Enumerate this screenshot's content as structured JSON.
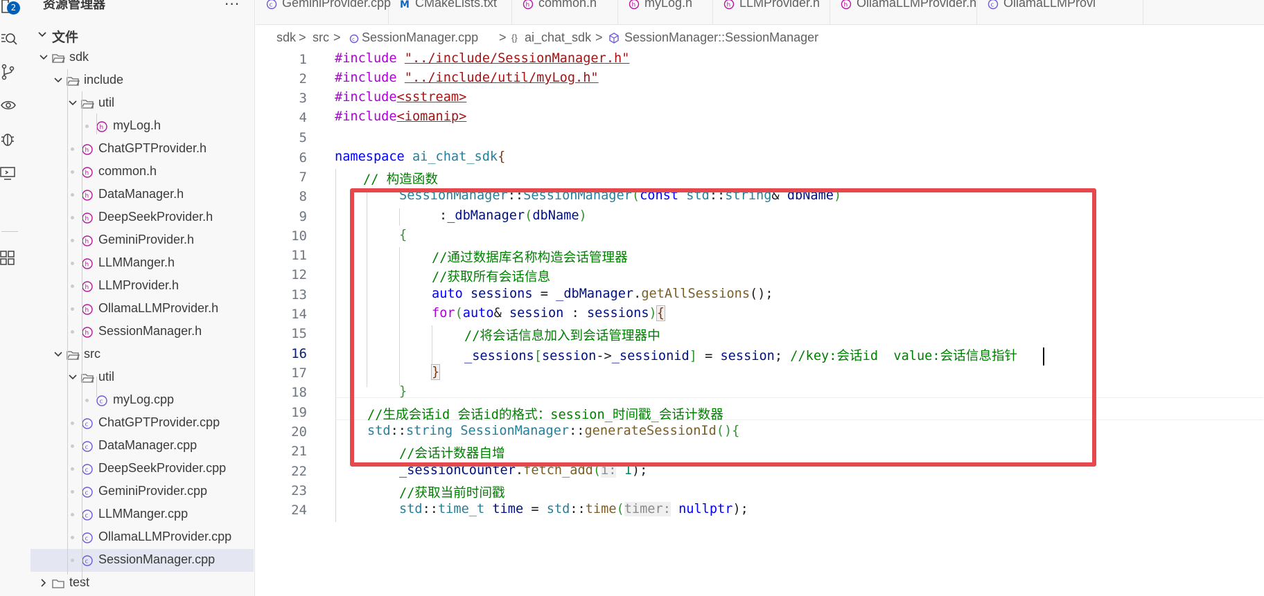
{
  "sidebar": {
    "title": "资源管理器",
    "more_label": "···",
    "section_label": "文件",
    "tree": [
      {
        "label": "sdk",
        "type": "folder-open"
      },
      {
        "label": "include",
        "type": "folder-open"
      },
      {
        "label": "util",
        "type": "folder-open"
      },
      {
        "label": "myLog.h",
        "type": "h"
      },
      {
        "label": "ChatGPTProvider.h",
        "type": "h"
      },
      {
        "label": "common.h",
        "type": "h"
      },
      {
        "label": "DataManager.h",
        "type": "h"
      },
      {
        "label": "DeepSeekProvider.h",
        "type": "h"
      },
      {
        "label": "GeminiProvider.h",
        "type": "h"
      },
      {
        "label": "LLMManger.h",
        "type": "h"
      },
      {
        "label": "LLMProvider.h",
        "type": "h"
      },
      {
        "label": "OllamaLLMProvider.h",
        "type": "h"
      },
      {
        "label": "SessionManager.h",
        "type": "h"
      },
      {
        "label": "src",
        "type": "folder-open"
      },
      {
        "label": "util",
        "type": "folder-open"
      },
      {
        "label": "myLog.cpp",
        "type": "cpp"
      },
      {
        "label": "ChatGPTProvider.cpp",
        "type": "cpp"
      },
      {
        "label": "DataManager.cpp",
        "type": "cpp"
      },
      {
        "label": "DeepSeekProvider.cpp",
        "type": "cpp"
      },
      {
        "label": "GeminiProvider.cpp",
        "type": "cpp"
      },
      {
        "label": "LLMManger.cpp",
        "type": "cpp"
      },
      {
        "label": "OllamaLLMProvider.cpp",
        "type": "cpp"
      },
      {
        "label": "SessionManager.cpp",
        "type": "cpp",
        "selected": true
      },
      {
        "label": "test",
        "type": "folder-closed"
      }
    ]
  },
  "activity_bar": {
    "badge": "2"
  },
  "tabs": [
    {
      "label": "GeminiProvider.cpp",
      "icon": "cpp-file-icon"
    },
    {
      "label": "CMakeLists.txt",
      "icon": "cmake-file-icon"
    },
    {
      "label": "common.h",
      "icon": "h-file-icon"
    },
    {
      "label": "myLog.h",
      "icon": "h-file-icon"
    },
    {
      "label": "LLMProvider.h",
      "icon": "h-file-icon"
    },
    {
      "label": "OllamaLLMProvider.h",
      "icon": "h-file-icon"
    },
    {
      "label": "OllamaLLMProvi",
      "icon": "cpp-file-icon"
    }
  ],
  "breadcrumb": {
    "items": [
      "sdk",
      "src",
      "SessionManager.cpp",
      "ai_chat_sdk",
      "SessionManager::SessionManager"
    ],
    "separator": ">",
    "ns_icon": "{}"
  },
  "editor": {
    "active_line": 16,
    "line_numbers": [
      "1",
      "2",
      "3",
      "4",
      "5",
      "6",
      "7",
      "8",
      "9",
      "10",
      "11",
      "12",
      "13",
      "14",
      "15",
      "16",
      "17",
      "18",
      "19",
      "20",
      "21",
      "22",
      "23",
      "24"
    ],
    "lines": {
      "l1": {
        "kw": "#include",
        "s": "\"../include/SessionManager.h\""
      },
      "l2": {
        "kw": "#include",
        "s": "\"../include/util/myLog.h\""
      },
      "l3": {
        "kw": "#include",
        "s": "<sstream>"
      },
      "l4": {
        "kw": "#include",
        "s": "<iomanip>"
      },
      "l6": {
        "kw": "namespace",
        "ns": "ai_chat_sdk",
        "br": "{"
      },
      "l7": {
        "c": "// 构造函数"
      },
      "l8": {
        "t": "SessionManager",
        "sep": "::",
        "f": "SessionManager",
        "p1": "(",
        "k": "const",
        "t2": "std",
        "sep2": "::",
        "t3": "string",
        "amp": "&",
        "v": "dbName",
        "p2": ")"
      },
      "l9": {
        "colon": ":",
        "v": "_dbManager",
        "p1": "(",
        "v2": "dbName",
        "p2": ")"
      },
      "l10": {
        "br": "{"
      },
      "l11": {
        "c": "//通过数据库名称构造会话管理器"
      },
      "l12": {
        "c": "//获取所有会话信息"
      },
      "l13": {
        "k": "auto",
        "v": "sessions",
        "eq": "=",
        "v2": "_dbManager",
        "dot": ".",
        "f": "getAllSessions",
        "rest": "();"
      },
      "l14": {
        "k": "for",
        "p1": "(",
        "k2": "auto",
        "amp": "&",
        "v": "session",
        "colon": ":",
        "v2": "sessions",
        "p2": ")",
        "br": "{"
      },
      "l15": {
        "c": "//将会话信息加入到会话管理器中"
      },
      "l16": {
        "v": "_sessions",
        "b1": "[",
        "v2": "session",
        "arrow": "->",
        "v3": "_sessionid",
        "b2": "]",
        "eq": "=",
        "v4": "session",
        "semi": ";",
        "c": "//key:会话id  value:会话信息指针"
      },
      "l17": {
        "br": "}"
      },
      "l18": {
        "br": "}"
      },
      "l19": {
        "c": "//生成会话id 会话id的格式：session_时间戳_会话计数器"
      },
      "l20": {
        "t": "std",
        "sep": "::",
        "t2": "string",
        "t3": "SessionManager",
        "sep2": "::",
        "f": "generateSessionId",
        "rest": "(){"
      },
      "l21": {
        "c": "//会话计数器自增"
      },
      "l22": {
        "v": "_sessionCounter",
        "dot": ".",
        "f": "fetch_add",
        "p1": "(",
        "hint": "i:",
        "num": "1",
        "rest": ");"
      },
      "l23": {
        "c": "//获取当前时间戳"
      },
      "l24": {
        "t": "std",
        "sep": "::",
        "t2": "time_t",
        "v": "time",
        "eq": "=",
        "t3": "std",
        "sep2": "::",
        "f": "time",
        "p1": "(",
        "hint": "timer:",
        "k": "nullptr",
        "rest": ");"
      }
    }
  },
  "colors": {
    "highlight_box": "#e5484d",
    "badge": "#005fb8",
    "selected_row": "#e4e6f1"
  }
}
